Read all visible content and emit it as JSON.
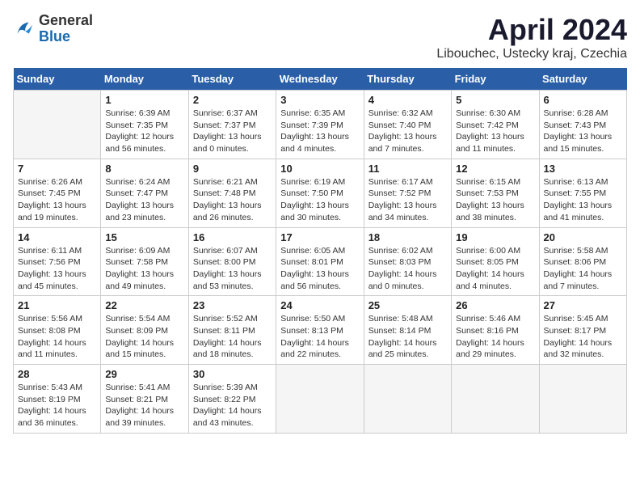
{
  "header": {
    "logo_general": "General",
    "logo_blue": "Blue",
    "title": "April 2024",
    "subtitle": "Libouchec, Ustecky kraj, Czechia"
  },
  "days_of_week": [
    "Sunday",
    "Monday",
    "Tuesday",
    "Wednesday",
    "Thursday",
    "Friday",
    "Saturday"
  ],
  "weeks": [
    [
      {
        "day": "",
        "info": ""
      },
      {
        "day": "1",
        "info": "Sunrise: 6:39 AM\nSunset: 7:35 PM\nDaylight: 12 hours\nand 56 minutes."
      },
      {
        "day": "2",
        "info": "Sunrise: 6:37 AM\nSunset: 7:37 PM\nDaylight: 13 hours\nand 0 minutes."
      },
      {
        "day": "3",
        "info": "Sunrise: 6:35 AM\nSunset: 7:39 PM\nDaylight: 13 hours\nand 4 minutes."
      },
      {
        "day": "4",
        "info": "Sunrise: 6:32 AM\nSunset: 7:40 PM\nDaylight: 13 hours\nand 7 minutes."
      },
      {
        "day": "5",
        "info": "Sunrise: 6:30 AM\nSunset: 7:42 PM\nDaylight: 13 hours\nand 11 minutes."
      },
      {
        "day": "6",
        "info": "Sunrise: 6:28 AM\nSunset: 7:43 PM\nDaylight: 13 hours\nand 15 minutes."
      }
    ],
    [
      {
        "day": "7",
        "info": "Sunrise: 6:26 AM\nSunset: 7:45 PM\nDaylight: 13 hours\nand 19 minutes."
      },
      {
        "day": "8",
        "info": "Sunrise: 6:24 AM\nSunset: 7:47 PM\nDaylight: 13 hours\nand 23 minutes."
      },
      {
        "day": "9",
        "info": "Sunrise: 6:21 AM\nSunset: 7:48 PM\nDaylight: 13 hours\nand 26 minutes."
      },
      {
        "day": "10",
        "info": "Sunrise: 6:19 AM\nSunset: 7:50 PM\nDaylight: 13 hours\nand 30 minutes."
      },
      {
        "day": "11",
        "info": "Sunrise: 6:17 AM\nSunset: 7:52 PM\nDaylight: 13 hours\nand 34 minutes."
      },
      {
        "day": "12",
        "info": "Sunrise: 6:15 AM\nSunset: 7:53 PM\nDaylight: 13 hours\nand 38 minutes."
      },
      {
        "day": "13",
        "info": "Sunrise: 6:13 AM\nSunset: 7:55 PM\nDaylight: 13 hours\nand 41 minutes."
      }
    ],
    [
      {
        "day": "14",
        "info": "Sunrise: 6:11 AM\nSunset: 7:56 PM\nDaylight: 13 hours\nand 45 minutes."
      },
      {
        "day": "15",
        "info": "Sunrise: 6:09 AM\nSunset: 7:58 PM\nDaylight: 13 hours\nand 49 minutes."
      },
      {
        "day": "16",
        "info": "Sunrise: 6:07 AM\nSunset: 8:00 PM\nDaylight: 13 hours\nand 53 minutes."
      },
      {
        "day": "17",
        "info": "Sunrise: 6:05 AM\nSunset: 8:01 PM\nDaylight: 13 hours\nand 56 minutes."
      },
      {
        "day": "18",
        "info": "Sunrise: 6:02 AM\nSunset: 8:03 PM\nDaylight: 14 hours\nand 0 minutes."
      },
      {
        "day": "19",
        "info": "Sunrise: 6:00 AM\nSunset: 8:05 PM\nDaylight: 14 hours\nand 4 minutes."
      },
      {
        "day": "20",
        "info": "Sunrise: 5:58 AM\nSunset: 8:06 PM\nDaylight: 14 hours\nand 7 minutes."
      }
    ],
    [
      {
        "day": "21",
        "info": "Sunrise: 5:56 AM\nSunset: 8:08 PM\nDaylight: 14 hours\nand 11 minutes."
      },
      {
        "day": "22",
        "info": "Sunrise: 5:54 AM\nSunset: 8:09 PM\nDaylight: 14 hours\nand 15 minutes."
      },
      {
        "day": "23",
        "info": "Sunrise: 5:52 AM\nSunset: 8:11 PM\nDaylight: 14 hours\nand 18 minutes."
      },
      {
        "day": "24",
        "info": "Sunrise: 5:50 AM\nSunset: 8:13 PM\nDaylight: 14 hours\nand 22 minutes."
      },
      {
        "day": "25",
        "info": "Sunrise: 5:48 AM\nSunset: 8:14 PM\nDaylight: 14 hours\nand 25 minutes."
      },
      {
        "day": "26",
        "info": "Sunrise: 5:46 AM\nSunset: 8:16 PM\nDaylight: 14 hours\nand 29 minutes."
      },
      {
        "day": "27",
        "info": "Sunrise: 5:45 AM\nSunset: 8:17 PM\nDaylight: 14 hours\nand 32 minutes."
      }
    ],
    [
      {
        "day": "28",
        "info": "Sunrise: 5:43 AM\nSunset: 8:19 PM\nDaylight: 14 hours\nand 36 minutes."
      },
      {
        "day": "29",
        "info": "Sunrise: 5:41 AM\nSunset: 8:21 PM\nDaylight: 14 hours\nand 39 minutes."
      },
      {
        "day": "30",
        "info": "Sunrise: 5:39 AM\nSunset: 8:22 PM\nDaylight: 14 hours\nand 43 minutes."
      },
      {
        "day": "",
        "info": ""
      },
      {
        "day": "",
        "info": ""
      },
      {
        "day": "",
        "info": ""
      },
      {
        "day": "",
        "info": ""
      }
    ]
  ]
}
